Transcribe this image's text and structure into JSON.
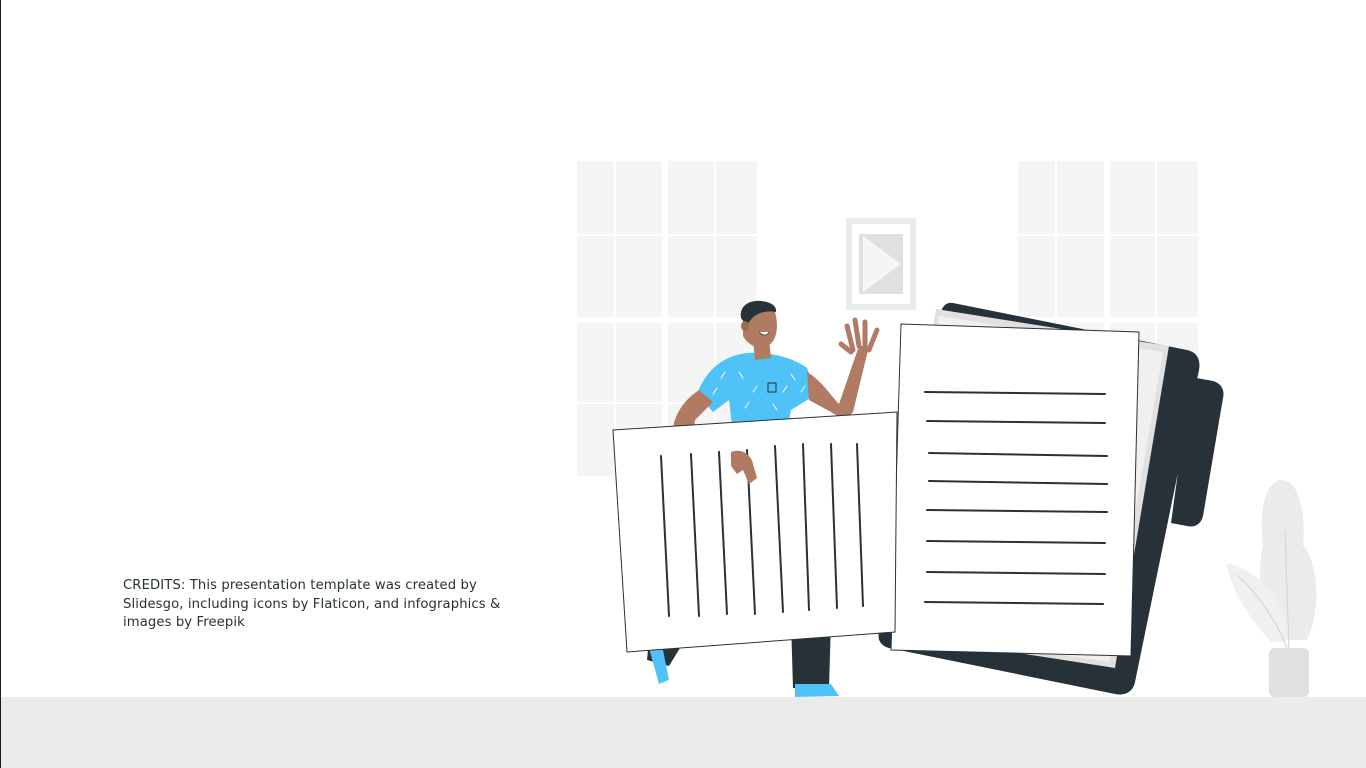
{
  "slide": {
    "credits_text": "CREDITS: This presentation template was created by Slidesgo, including icons by Flaticon, and infographics & images by Freepik"
  },
  "illustration": {
    "subject": "man-carrying-documents",
    "colors": {
      "shirt": "#4fc3f7",
      "skin": "#b07a63",
      "dark": "#263238",
      "window": "#f5f5f5",
      "floor": "#ebebeb"
    }
  }
}
